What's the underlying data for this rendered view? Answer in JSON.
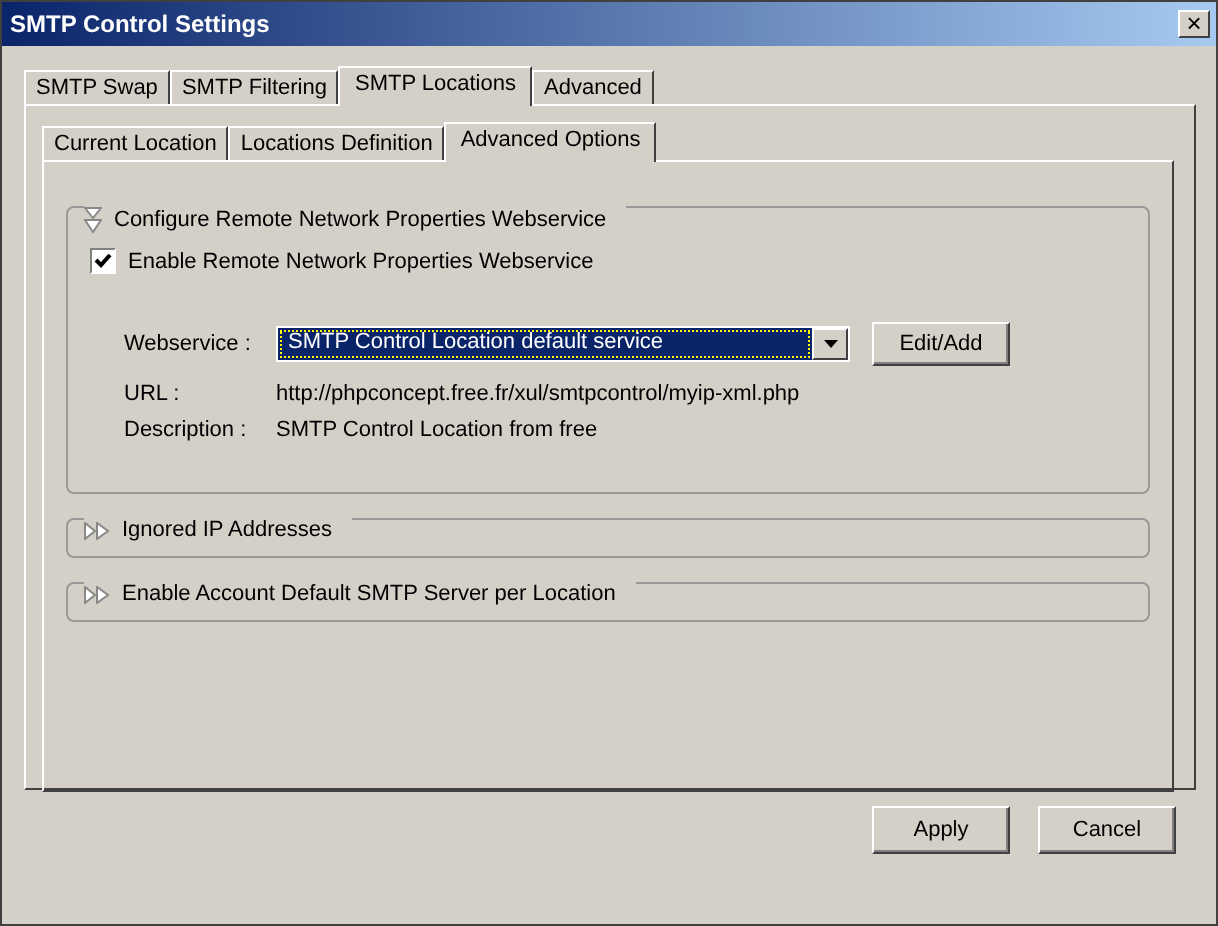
{
  "window": {
    "title": "SMTP Control Settings",
    "close": "×"
  },
  "tabs": [
    {
      "label": "SMTP Swap",
      "selected": false
    },
    {
      "label": "SMTP Filtering",
      "selected": false
    },
    {
      "label": "SMTP Locations",
      "selected": true
    },
    {
      "label": "Advanced",
      "selected": false
    }
  ],
  "subtabs": [
    {
      "label": "Current Location",
      "selected": false
    },
    {
      "label": "Locations Definition",
      "selected": false
    },
    {
      "label": "Advanced Options",
      "selected": true
    }
  ],
  "sections": [
    {
      "title": "Configure Remote Network Properties Webservice",
      "expanded": true,
      "checkbox": {
        "label": "Enable Remote Network Properties Webservice",
        "checked": true
      },
      "webservice": {
        "label": "Webservice :",
        "value": "SMTP Control Location default service",
        "button": "Edit/Add"
      },
      "rows": [
        {
          "label": "URL :",
          "value": "http://phpconcept.free.fr/xul/smtpcontrol/myip-xml.php"
        },
        {
          "label": "Description :",
          "value": "SMTP Control Location from free"
        }
      ]
    },
    {
      "title": "Ignored IP Addresses",
      "expanded": false
    },
    {
      "title": "Enable Account Default SMTP Server per Location",
      "expanded": false
    }
  ],
  "buttons": [
    "Apply",
    "Cancel"
  ]
}
